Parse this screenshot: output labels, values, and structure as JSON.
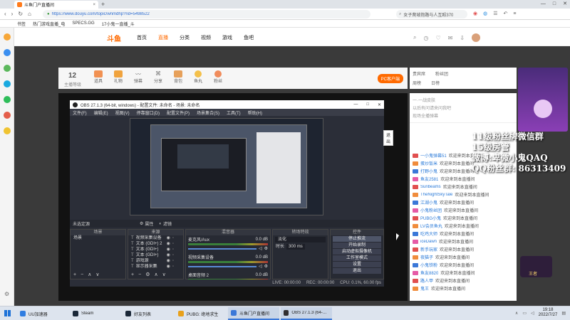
{
  "browser": {
    "tab_title": "斗鱼门户直播间",
    "url": "https://www.douyu.com/topic/wnmdhp?rid=5498522",
    "search_hint": "女子爬坡抱路与人互殴370",
    "bookmarks": [
      "书签",
      "热门游戏直播_电",
      "SPECS.GG",
      "17小鬼一直播_斗"
    ]
  },
  "douyu": {
    "logo": "斗鱼",
    "nav": [
      "首页",
      "直播",
      "分类",
      "视频",
      "游戏",
      "鱼吧"
    ],
    "room_level": "12",
    "room_level_label": "主播等级",
    "room_tools": [
      "道具",
      "礼物",
      "弹幕",
      "分享",
      "背包",
      "鱼丸",
      "粉丝"
    ],
    "pc_client": "PC客户端",
    "rank_tabs": [
      "贵宾席",
      "粉丝团",
      "周榜",
      "日榜"
    ],
    "chat_top": [
      "一·一战皮肤",
      "以后有问请来问我吧",
      "现场全播弹幕"
    ],
    "chat": [
      {
        "user": "一小鬼弹幕51",
        "msg": "欢迎来到本直播间"
      },
      {
        "user": "蛋炒饭米",
        "msg": "欢迎来到本直播间"
      },
      {
        "user": "打野小鬼",
        "msg": "欢迎来到本直播间"
      },
      {
        "user": "鱼友2581",
        "msg": "欢迎来到本直播间"
      },
      {
        "user": "Sunbeams",
        "msg": "欢迎来到本直播间"
      },
      {
        "user": "TheNightSkyTale",
        "msg": "欢迎来到本直播间"
      },
      {
        "user": "江湖小鬼",
        "msg": "欢迎来到本直播间"
      },
      {
        "user": "小鬼粉丝团",
        "msg": "欢迎来到本直播间"
      },
      {
        "user": "PUBG小鬼",
        "msg": "欢迎来到本直播间"
      },
      {
        "user": "LV会员鱼丸",
        "msg": "欢迎来到本直播间"
      },
      {
        "user": "吃鸡大师",
        "msg": "欢迎来到本直播间"
      },
      {
        "user": "iceDawn",
        "msg": "欢迎来到本直播间"
      },
      {
        "user": "新手玩家",
        "msg": "欢迎来到本直播间"
      },
      {
        "user": "夜猫子",
        "msg": "欢迎来到本直播间"
      },
      {
        "user": "小鬼铁粉",
        "msg": "欢迎来到本直播间"
      },
      {
        "user": "鱼友8820",
        "msg": "欢迎来到本直播间"
      },
      {
        "user": "路人甲",
        "msg": "欢迎来到本直播间"
      },
      {
        "user": "鬼王",
        "msg": "欢迎来到本直播间"
      }
    ],
    "badge": "王者"
  },
  "overlay": {
    "line1": "11级粉丝牌微信群",
    "line2": "15级房管",
    "line3": "微博:卑微小鬼QAQ",
    "line4": "QQ粉丝群: 86313409"
  },
  "obs": {
    "title": "OBS 27.1.3 (64-bit, windows) - 配置文件: 未命名 - 场景: 未命名",
    "menu": [
      "文件(F)",
      "编辑(E)",
      "视图(V)",
      "停靠窗口(D)",
      "配置文件(P)",
      "场景集合(S)",
      "工具(T)",
      "帮助(H)"
    ],
    "exit_fullscreen": "退出",
    "scene_bar": "未选定源",
    "props_btn": "属性",
    "filter_btn": "滤镜",
    "scenes_header": "场景",
    "scenes": [
      "场景"
    ],
    "sources_header": "来源",
    "sources": [
      "视频采集设备",
      "文本 (GDI+) 2",
      "文本 (GDI+)",
      "文本 (GDI+)",
      "游戏源",
      "显示器采集"
    ],
    "mixer_header": "混音器",
    "mixer": [
      {
        "name": "麦克风/Aux",
        "db": "0.0 dB"
      },
      {
        "name": "视频采集设备",
        "db": "0.0 dB"
      },
      {
        "name": "桌面音频 2",
        "db": "0.0 dB"
      }
    ],
    "transition_header": "转场特效",
    "transition": "淡化",
    "duration_label": "时长",
    "duration": "300 ms",
    "controls_header": "控件",
    "controls": [
      "停止推流",
      "开始录制",
      "启动虚拟摄像机",
      "工作室模式",
      "设置",
      "退出"
    ],
    "status": {
      "live": "LIVE: 00:00:00",
      "rec": "REC: 00:00:00",
      "cpu": "CPU: 0.1%, 60.00 fps"
    }
  },
  "taskbar": {
    "items": [
      {
        "label": "UU加速器",
        "color": "#2f7de1"
      },
      {
        "label": "Steam",
        "color": "#1b2838"
      },
      {
        "label": "好友列表",
        "color": "#1b2838"
      },
      {
        "label": "PUBG: 绝地求生",
        "color": "#e8a11c"
      },
      {
        "label": "斗鱼门户直播间",
        "color": "#3b78d8"
      },
      {
        "label": "OBS 27.1.3 (64-bit...)",
        "color": "#302e31"
      }
    ],
    "time": "19:18",
    "date": "2022/7/27"
  }
}
